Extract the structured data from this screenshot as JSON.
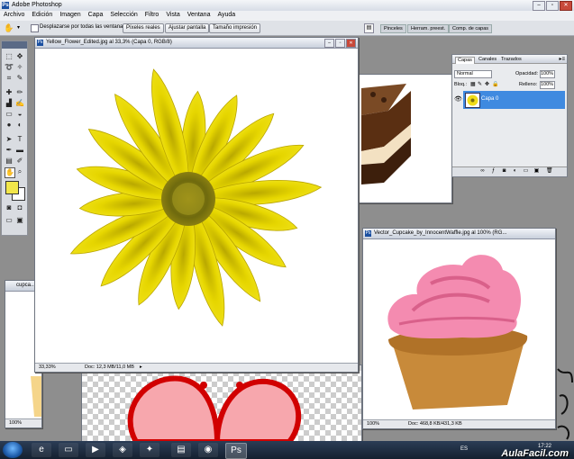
{
  "app": {
    "title": "Adobe Photoshop",
    "icon": "Ps"
  },
  "menu": [
    "Archivo",
    "Edición",
    "Imagen",
    "Capa",
    "Selección",
    "Filtro",
    "Vista",
    "Ventana",
    "Ayuda"
  ],
  "options": {
    "scroll_all_label": "Desplazarse por todas las ventanas",
    "buttons": [
      "Píxeles reales",
      "Ajustar pantalla",
      "Tamaño impresión"
    ]
  },
  "panel_well": [
    "Pinceles",
    "Herram. preest.",
    "Comp. de capas"
  ],
  "documents": {
    "flower": {
      "title": "Yellow_Flower_Edited.jpg al 33,3% (Capa 0, RGB/8)",
      "zoom": "33,33%",
      "doc": "Doc: 12,3 MB/11,0 MB"
    },
    "cupcake_vector": {
      "title": "Vector_Cupcake_by_InnocentWaffle.jpg al 100% (RG...",
      "zoom": "100%",
      "doc": "Doc: 468,8 KB/431,3 KB"
    },
    "cupcake_small": {
      "title": "cupca...",
      "zoom": "100%"
    }
  },
  "layers": {
    "tabs": [
      "Capas",
      "Canales",
      "Trazados"
    ],
    "blend_mode": "Normal",
    "opacity_label": "Opacidad:",
    "opacity": "100%",
    "lock_label": "Bloq.:",
    "fill_label": "Relleno:",
    "fill": "100%",
    "layer_name": "Capa 0"
  },
  "taskbar": {
    "lang": "ES",
    "time": "17:22"
  },
  "watermark": "AulaFacil.com",
  "colors": {
    "foreground": "#f2e64a",
    "background": "#ffffff",
    "selection": "#3f8ae0"
  }
}
